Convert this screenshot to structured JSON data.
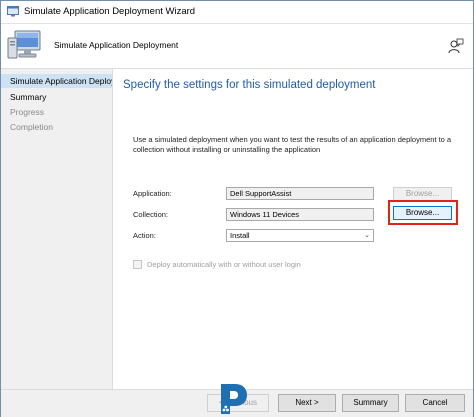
{
  "window": {
    "title": "Simulate Application Deployment Wizard"
  },
  "banner": {
    "title": "Simulate Application Deployment",
    "icon": "computer-monitor-icon",
    "help_icon": "help-person-icon"
  },
  "sidebar": {
    "items": [
      {
        "label": "Simulate Application Deployment",
        "state": "active"
      },
      {
        "label": "Summary",
        "state": "normal"
      },
      {
        "label": "Progress",
        "state": "dim"
      },
      {
        "label": "Completion",
        "state": "dim"
      }
    ]
  },
  "content": {
    "heading": "Specify the settings for this simulated deployment",
    "description": "Use a simulated deployment when you want to test the results of an application deployment to a collection without installing or uninstalling the application",
    "application_label": "Application:",
    "application_value": "Dell SupportAssist",
    "application_browse": "Browse...",
    "collection_label": "Collection:",
    "collection_value": "Windows 11 Devices",
    "collection_browse": "Browse...",
    "action_label": "Action:",
    "action_value": "Install",
    "auto_deploy_label": "Deploy automatically with or without user login"
  },
  "footer": {
    "previous_label": "< Previous",
    "next_label": "Next >",
    "summary_label": "Summary",
    "cancel_label": "Cancel"
  },
  "colors": {
    "heading": "#1f5da8",
    "highlight": "#e2231a",
    "nav_active": "#cde3f5"
  }
}
